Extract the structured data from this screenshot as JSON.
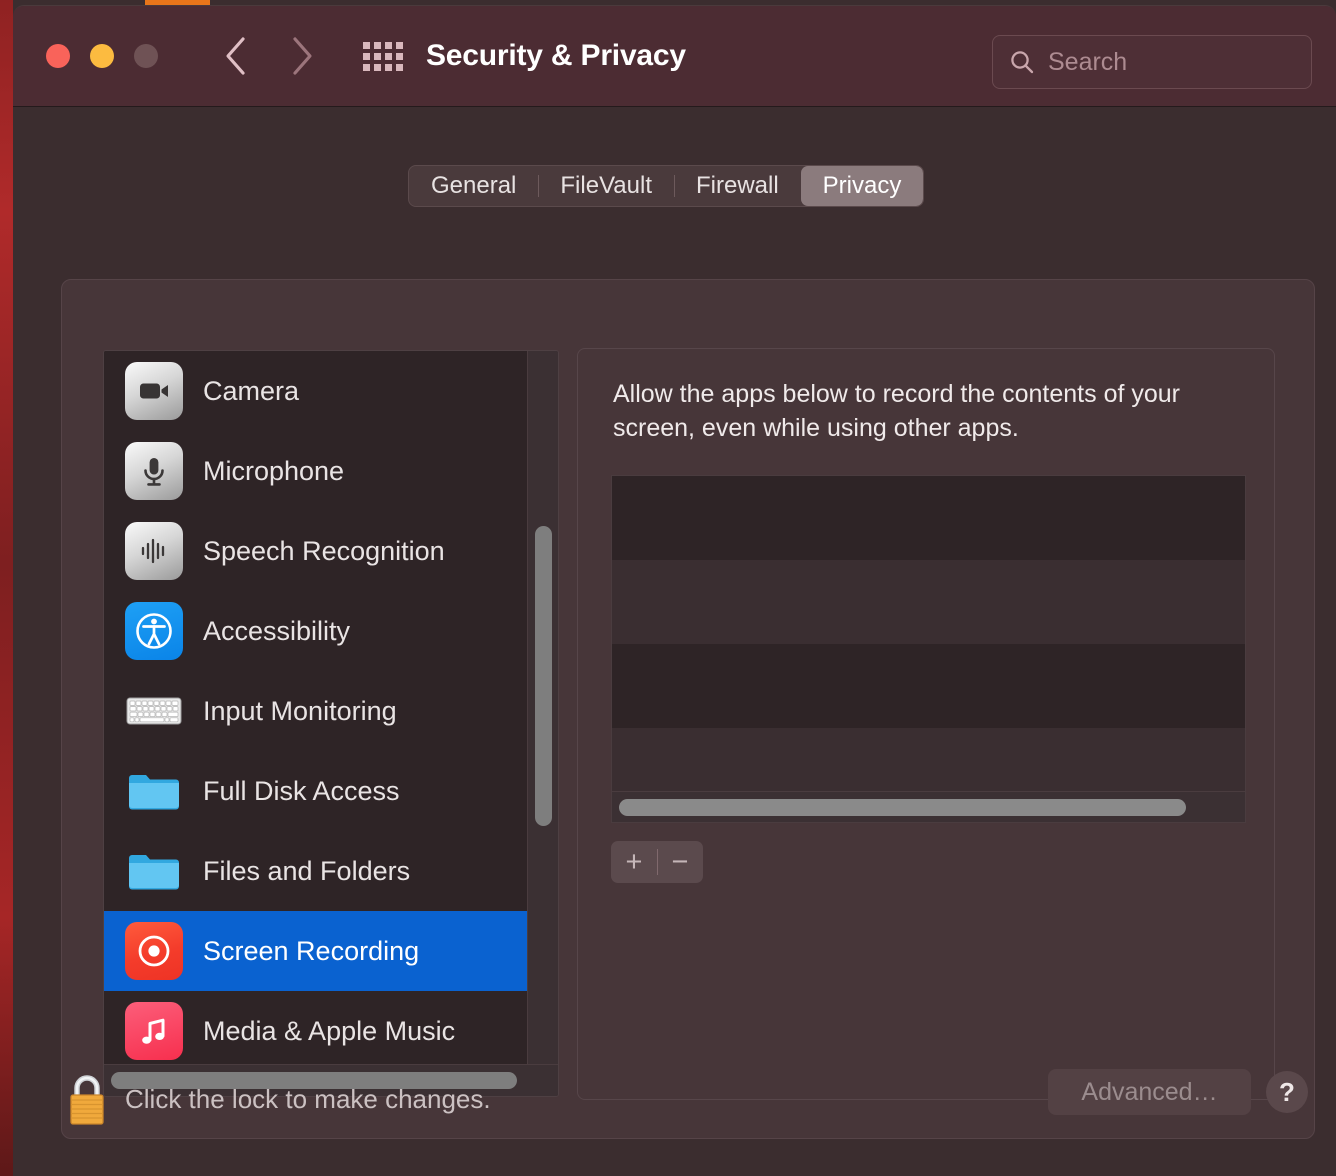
{
  "window": {
    "title": "Security & Privacy",
    "traffic_lights": [
      "close",
      "minimize",
      "maximize"
    ],
    "nav_back_icon": "chevron-left-icon",
    "nav_forward_icon": "chevron-right-icon",
    "grid_icon": "grid-apps-icon"
  },
  "search": {
    "placeholder": "Search",
    "value": "",
    "icon": "search-icon"
  },
  "tabs": [
    {
      "label": "General",
      "active": false
    },
    {
      "label": "FileVault",
      "active": false
    },
    {
      "label": "Firewall",
      "active": false
    },
    {
      "label": "Privacy",
      "active": true
    }
  ],
  "sidebar": {
    "items": [
      {
        "label": "Camera",
        "icon": "camera-icon",
        "selected": false
      },
      {
        "label": "Microphone",
        "icon": "microphone-icon",
        "selected": false
      },
      {
        "label": "Speech Recognition",
        "icon": "waveform-icon",
        "selected": false
      },
      {
        "label": "Accessibility",
        "icon": "accessibility-icon",
        "selected": false
      },
      {
        "label": "Input Monitoring",
        "icon": "keyboard-icon",
        "selected": false
      },
      {
        "label": "Full Disk Access",
        "icon": "folder-icon",
        "selected": false
      },
      {
        "label": "Files and Folders",
        "icon": "folder-icon",
        "selected": false
      },
      {
        "label": "Screen Recording",
        "icon": "screen-recording-icon",
        "selected": true
      },
      {
        "label": "Media & Apple Music",
        "icon": "music-note-icon",
        "selected": false
      }
    ],
    "selected_label": "Screen Recording"
  },
  "detail": {
    "description": "Allow the apps below to record the contents of your screen, even while using other apps.",
    "app_list": [],
    "empty_row_count": 4,
    "add_label": "+",
    "remove_label": "−"
  },
  "bottom": {
    "lock_icon": "closed-lock-icon",
    "lock_text": "Click the lock to make changes.",
    "advanced_label": "Advanced…",
    "advanced_enabled": false,
    "help_label": "?"
  },
  "colors": {
    "titlebar": "#4c2c33",
    "window_bg": "#3b2d2f",
    "panel_bg": "#473639",
    "list_bg": "#2e2426",
    "selection_blue": "#0a62d0",
    "accent_red": "#f43c2b",
    "lock_gold": "#f0a93c"
  }
}
